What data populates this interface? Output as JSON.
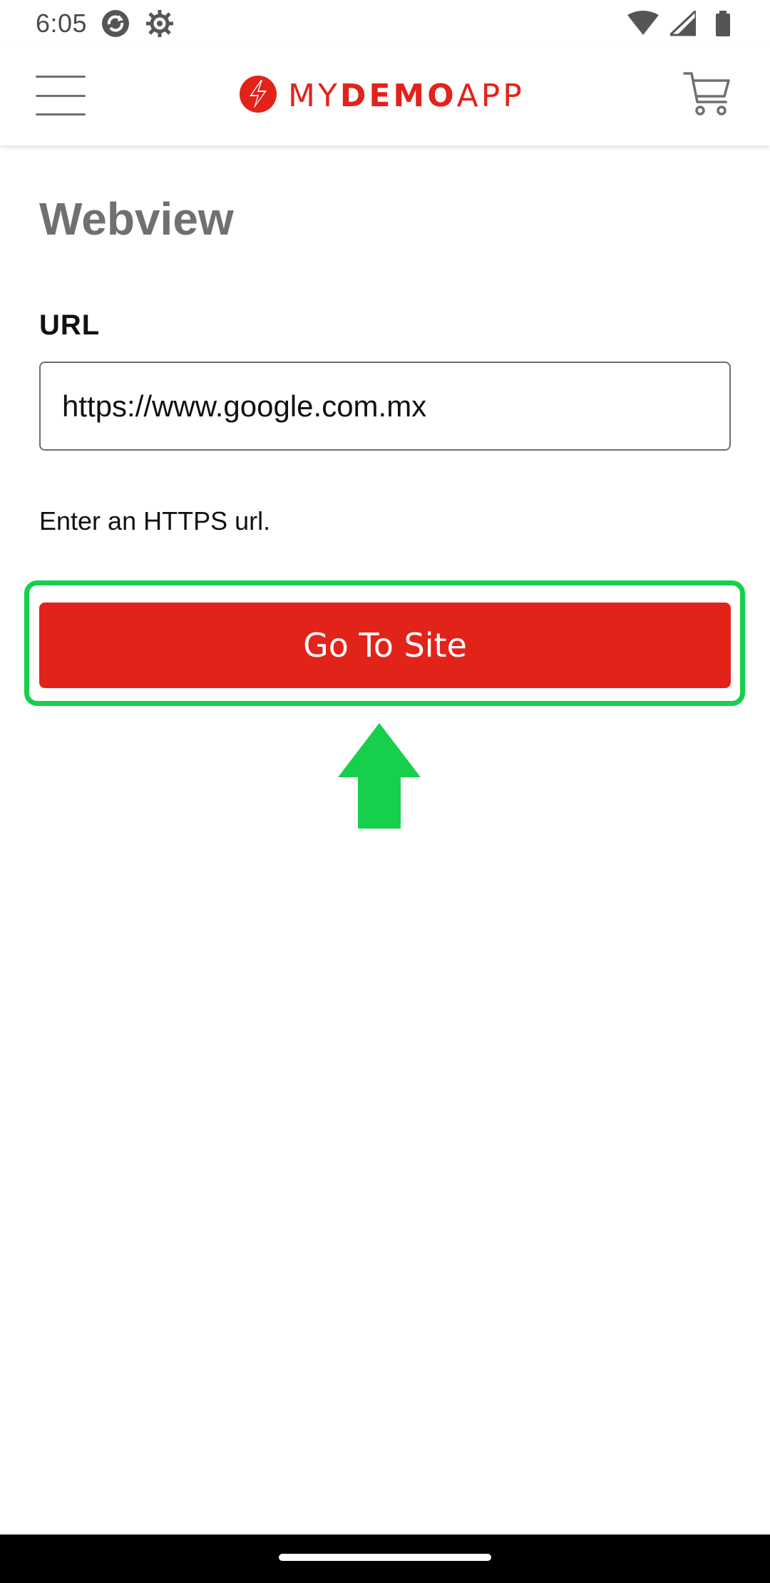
{
  "status_bar": {
    "time": "6:05",
    "icons": [
      "sync-icon",
      "settings-gear-icon",
      "wifi-icon",
      "signal-icon",
      "battery-icon"
    ]
  },
  "header": {
    "menu_icon": "hamburger-menu-icon",
    "logo": {
      "part1": "MY",
      "part2": "DEMO",
      "part3": "APP",
      "icon": "lightning-bolt-icon"
    },
    "cart_icon": "shopping-cart-icon"
  },
  "page": {
    "title": "Webview",
    "url_label": "URL",
    "url_value": "https://www.google.com.mx",
    "helper_text": "Enter an HTTPS url.",
    "go_button_label": "Go To Site"
  },
  "annotation": {
    "highlight_color": "#16d04b",
    "arrow_icon": "up-arrow-icon"
  },
  "colors": {
    "brand": "#e2231a",
    "title_gray": "#707070"
  }
}
